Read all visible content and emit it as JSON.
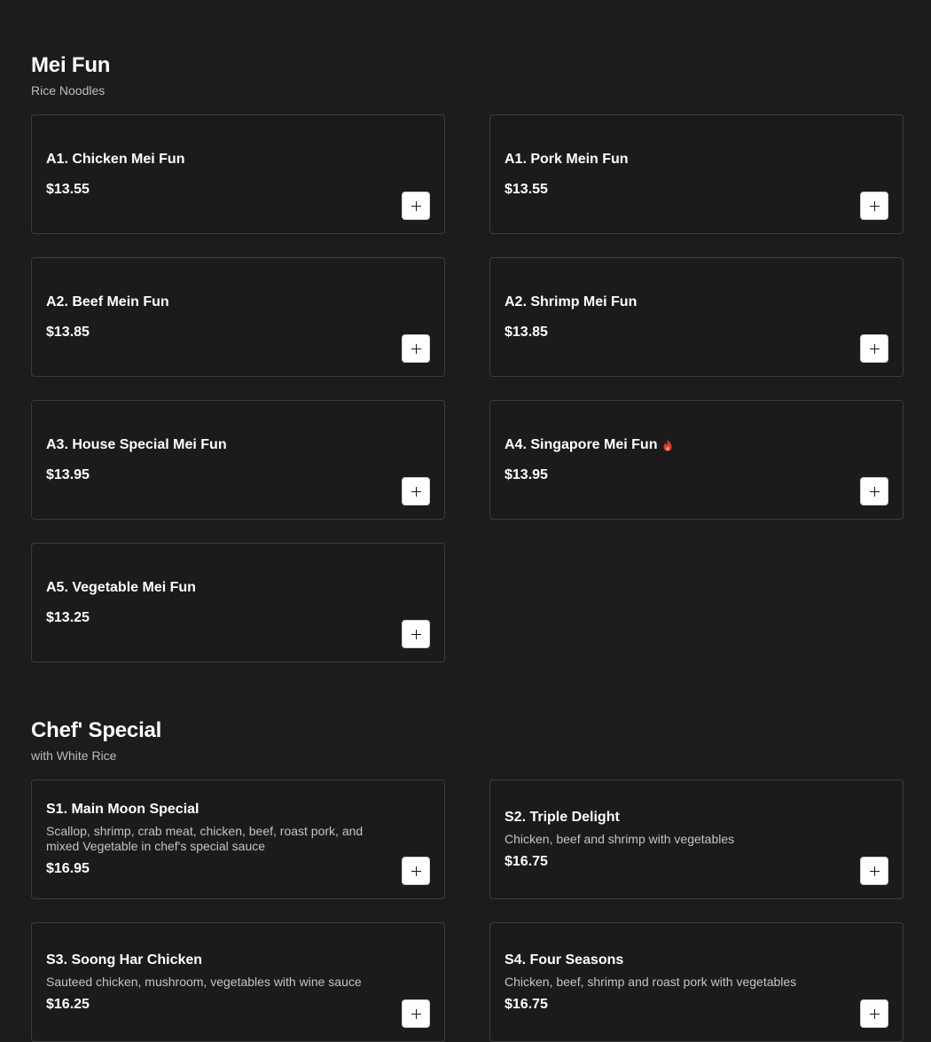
{
  "colors": {
    "background": "#1c1c1c",
    "card_border": "#3c3c3c",
    "text": "#ffffff",
    "subtext": "#c4c4c4",
    "add_button": "#ffffff",
    "spicy": "#e53935"
  },
  "sections": [
    {
      "title": "Mei Fun",
      "subtitle": "Rice Noodles",
      "items": [
        {
          "name": "A1. Chicken Mei Fun",
          "price": "$13.55"
        },
        {
          "name": "A1. Pork Mein Fun",
          "price": "$13.55"
        },
        {
          "name": "A2. Beef Mein Fun",
          "price": "$13.85"
        },
        {
          "name": "A2. Shrimp Mei Fun",
          "price": "$13.85"
        },
        {
          "name": "A3. House Special Mei Fun",
          "price": "$13.95"
        },
        {
          "name": "A4. Singapore Mei Fun",
          "price": "$13.95",
          "icon": "spicy-flame-icon"
        },
        {
          "name": "A5. Vegetable Mei Fun",
          "price": "$13.25"
        }
      ]
    },
    {
      "title": "Chef' Special",
      "subtitle": "with White Rice",
      "items": [
        {
          "name": "S1. Main Moon Special",
          "description": "Scallop, shrimp, crab meat, chicken, beef, roast pork, and mixed Vegetable in chef's special sauce",
          "price": "$16.95"
        },
        {
          "name": "S2. Triple Delight",
          "description": "Chicken, beef and shrimp with vegetables",
          "price": "$16.75"
        },
        {
          "name": "S3. Soong Har Chicken",
          "description": "Sauteed chicken, mushroom, vegetables with wine sauce",
          "price": "$16.25"
        },
        {
          "name": "S4. Four Seasons",
          "description": "Chicken, beef, shrimp and roast pork with vegetables",
          "price": "$16.75"
        }
      ]
    }
  ]
}
